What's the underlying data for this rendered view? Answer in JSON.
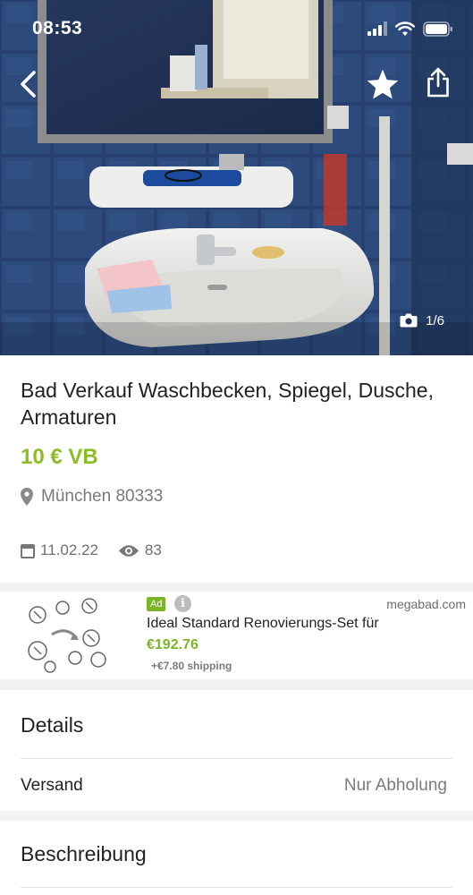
{
  "status_bar": {
    "time": "08:53"
  },
  "hero": {
    "image_counter": "1/6",
    "icons": {
      "back": "chevron-left-icon",
      "favorite": "star-icon",
      "share": "share-icon",
      "camera": "camera-icon"
    }
  },
  "listing": {
    "title": "Bad Verkauf Waschbecken, Spiegel, Dusche,  Armaturen",
    "price": "10 € VB",
    "location": "München 80333",
    "date": "11.02.22",
    "views": "83"
  },
  "ad": {
    "badge": "Ad",
    "info": "i",
    "domain": "megabad.com",
    "title": "Ideal Standard Renovierungs-Set für",
    "price": "€192.76",
    "shipping": "+€7.80 shipping"
  },
  "details": {
    "heading": "Details",
    "rows": [
      {
        "label": "Versand",
        "value": "Nur Abholung"
      }
    ]
  },
  "description": {
    "heading": "Beschreibung"
  },
  "colors": {
    "price_green": "#8bbd27",
    "ad_green": "#7bb526",
    "tile_blue": "#2a3f6e"
  }
}
